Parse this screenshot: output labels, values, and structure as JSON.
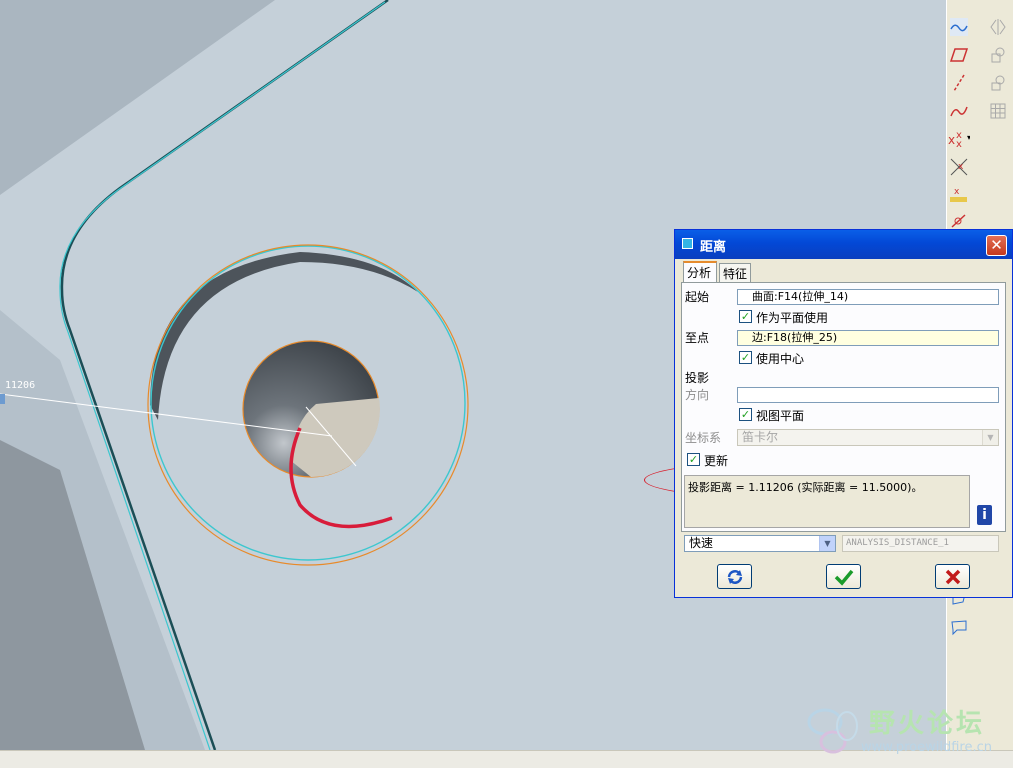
{
  "viewport": {
    "dimension_label": "11206",
    "icons": [
      "cad-geometry"
    ]
  },
  "toolbar": {
    "icons": [
      "curve-icon",
      "plane-icon",
      "axis-icon",
      "sketch-curve-icon",
      "point-icon",
      "offset-point-icon",
      "field-point-icon",
      "csys-icon",
      "mirror-icon",
      "copy-icon",
      "pattern-icon",
      "grid-icon",
      "note-icon"
    ]
  },
  "dialog": {
    "title": "距离",
    "close_glyph": "✕",
    "tabs": [
      "分析",
      "特征"
    ],
    "from_label": "起始",
    "from_value": "曲面:F14(拉伸_14)",
    "use_as_plane_label": "作为平面使用",
    "to_label": "至点",
    "to_value": "边:F18(拉伸_25)",
    "use_center_label": "使用中心",
    "projection_label": "投影",
    "direction_label": "方向",
    "direction_value": "",
    "view_plane_label": "视图平面",
    "csys_label": "坐标系",
    "csys_value": "笛卡尔",
    "update_label": "更新",
    "result_text": "投影距离 = 1.11206 (实际距离 = 11.5000)。",
    "info_glyph": "i",
    "mode_value": "快速",
    "analysis_name": "ANALYSIS_DISTANCE_1",
    "checks": {
      "use_as_plane": true,
      "use_center": true,
      "view_plane": true,
      "update": true
    }
  },
  "watermark": {
    "title": "野火论坛",
    "url": "www.proewildfire.cn"
  },
  "colors": {
    "background": "#c5d0d9",
    "edge_cyan": "#3cc7cf",
    "edge_orange": "#e88a2a",
    "highlight_red": "#d81c3a",
    "titlebar": "#0348d6"
  }
}
